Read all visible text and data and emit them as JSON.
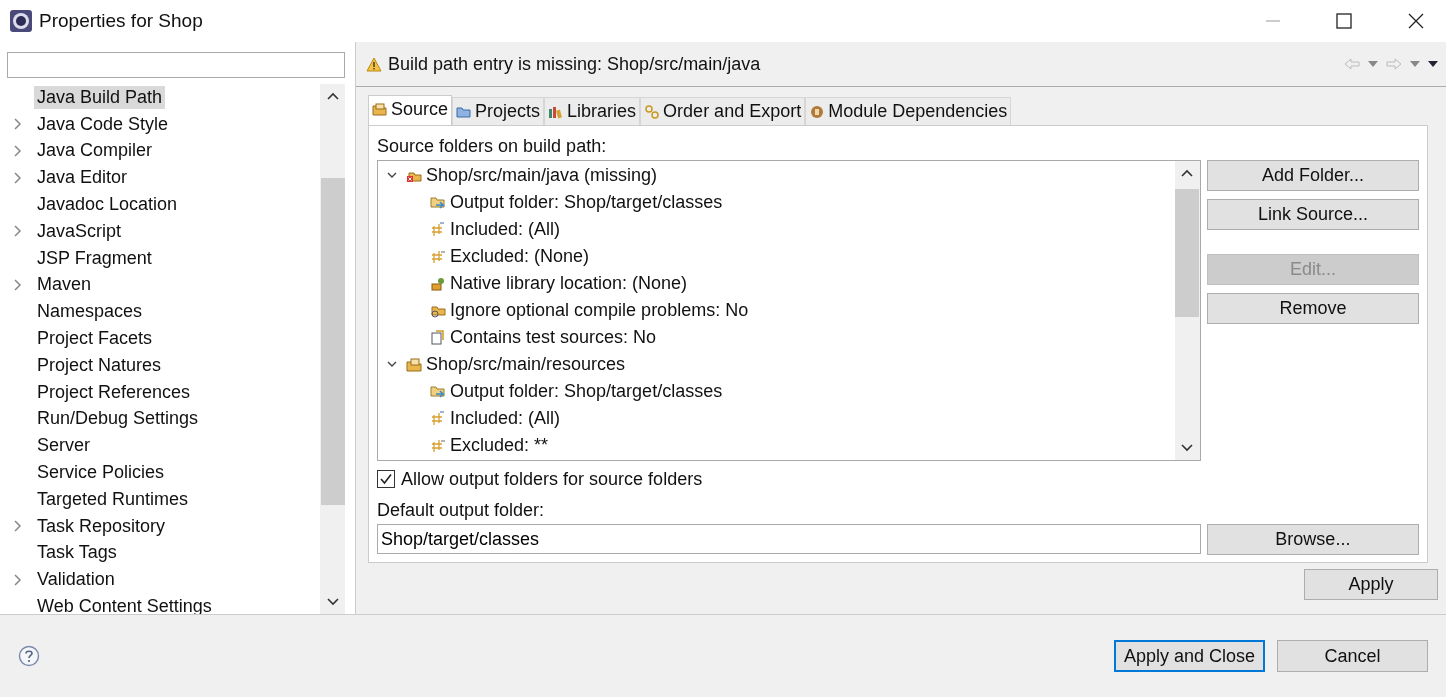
{
  "window": {
    "title": "Properties for Shop"
  },
  "nav_items": [
    {
      "label": "Java Build Path",
      "expandable": false,
      "selected": true
    },
    {
      "label": "Java Code Style",
      "expandable": true,
      "selected": false
    },
    {
      "label": "Java Compiler",
      "expandable": true,
      "selected": false
    },
    {
      "label": "Java Editor",
      "expandable": true,
      "selected": false
    },
    {
      "label": "Javadoc Location",
      "expandable": false,
      "selected": false
    },
    {
      "label": "JavaScript",
      "expandable": true,
      "selected": false
    },
    {
      "label": "JSP Fragment",
      "expandable": false,
      "selected": false
    },
    {
      "label": "Maven",
      "expandable": true,
      "selected": false
    },
    {
      "label": "Namespaces",
      "expandable": false,
      "selected": false
    },
    {
      "label": "Project Facets",
      "expandable": false,
      "selected": false
    },
    {
      "label": "Project Natures",
      "expandable": false,
      "selected": false
    },
    {
      "label": "Project References",
      "expandable": false,
      "selected": false
    },
    {
      "label": "Run/Debug Settings",
      "expandable": false,
      "selected": false
    },
    {
      "label": "Server",
      "expandable": false,
      "selected": false
    },
    {
      "label": "Service Policies",
      "expandable": false,
      "selected": false
    },
    {
      "label": "Targeted Runtimes",
      "expandable": false,
      "selected": false
    },
    {
      "label": "Task Repository",
      "expandable": true,
      "selected": false
    },
    {
      "label": "Task Tags",
      "expandable": false,
      "selected": false
    },
    {
      "label": "Validation",
      "expandable": true,
      "selected": false
    },
    {
      "label": "Web Content Settings",
      "expandable": false,
      "selected": false
    }
  ],
  "message": "Build path entry is missing: Shop/src/main/java",
  "tabs": [
    {
      "label": "Source",
      "kind": "source",
      "selected": true
    },
    {
      "label": "Projects",
      "kind": "projects",
      "selected": false
    },
    {
      "label": "Libraries",
      "kind": "libraries",
      "selected": false
    },
    {
      "label": "Order and Export",
      "kind": "order",
      "selected": false
    },
    {
      "label": "Module Dependencies",
      "kind": "module",
      "selected": false
    }
  ],
  "source_label": "Source folders on build path:",
  "source_tree": [
    {
      "label": "Shop/src/main/java (missing)",
      "kind": "missing-folder",
      "expanded": true,
      "children": [
        {
          "label": "Output folder: Shop/target/classes",
          "kind": "output"
        },
        {
          "label": "Included: (All)",
          "kind": "included"
        },
        {
          "label": "Excluded: (None)",
          "kind": "excluded"
        },
        {
          "label": "Native library location: (None)",
          "kind": "native"
        },
        {
          "label": "Ignore optional compile problems: No",
          "kind": "ignore"
        },
        {
          "label": "Contains test sources: No",
          "kind": "test"
        }
      ]
    },
    {
      "label": "Shop/src/main/resources",
      "kind": "folder",
      "expanded": true,
      "children": [
        {
          "label": "Output folder: Shop/target/classes",
          "kind": "output"
        },
        {
          "label": "Included: (All)",
          "kind": "included"
        },
        {
          "label": "Excluded: **",
          "kind": "excluded"
        }
      ]
    }
  ],
  "side_buttons": [
    {
      "label": "Add Folder...",
      "disabled": false
    },
    {
      "label": "Link Source...",
      "disabled": false
    },
    {
      "label": "Edit...",
      "disabled": true
    },
    {
      "label": "Remove",
      "disabled": false
    }
  ],
  "allow_output": {
    "label": "Allow output folders for source folders",
    "checked": true
  },
  "default_output": {
    "label": "Default output folder:",
    "value": "Shop/target/classes",
    "browse": "Browse..."
  },
  "apply": "Apply",
  "footer_buttons": [
    {
      "label": "Apply and Close",
      "default": true
    },
    {
      "label": "Cancel",
      "default": false
    }
  ]
}
